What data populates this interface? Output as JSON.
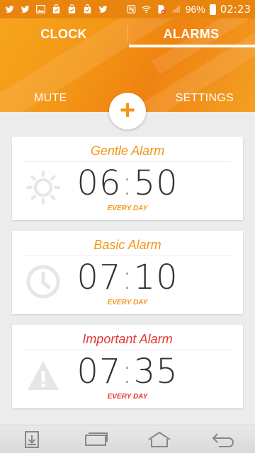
{
  "status_bar": {
    "battery": "96%",
    "time": "02:23",
    "icons": [
      "twitter-icon",
      "twitter-icon",
      "image-icon",
      "shopping-bag-icon",
      "shopping-bag-icon",
      "shopping-bag-icon",
      "twitter-icon",
      "nfc-icon",
      "wifi-icon",
      "sim-icon",
      "signal-icon",
      "battery-icon"
    ]
  },
  "tabs": [
    {
      "label": "CLOCK",
      "active": false
    },
    {
      "label": "ALARMS",
      "active": true
    }
  ],
  "header_actions": {
    "mute_label": "MUTE",
    "settings_label": "SETTINGS",
    "add_label": "+"
  },
  "alarms": [
    {
      "title": "Gentle Alarm",
      "hours": "06",
      "minutes": "50",
      "repeat": "EVERY DAY",
      "color": "#f39616",
      "icon": "sun-icon"
    },
    {
      "title": "Basic Alarm",
      "hours": "07",
      "minutes": "10",
      "repeat": "EVERY DAY",
      "color": "#f39616",
      "icon": "clock-icon"
    },
    {
      "title": "Important Alarm",
      "hours": "07",
      "minutes": "35",
      "repeat": "EVERY DAY",
      "color": "#e53935",
      "icon": "warning-icon"
    }
  ],
  "colors": {
    "accent": "#f39616",
    "important": "#e53935"
  },
  "nav_bar": {
    "icons": [
      "download-icon",
      "recent-apps-icon",
      "home-icon",
      "back-icon"
    ]
  }
}
